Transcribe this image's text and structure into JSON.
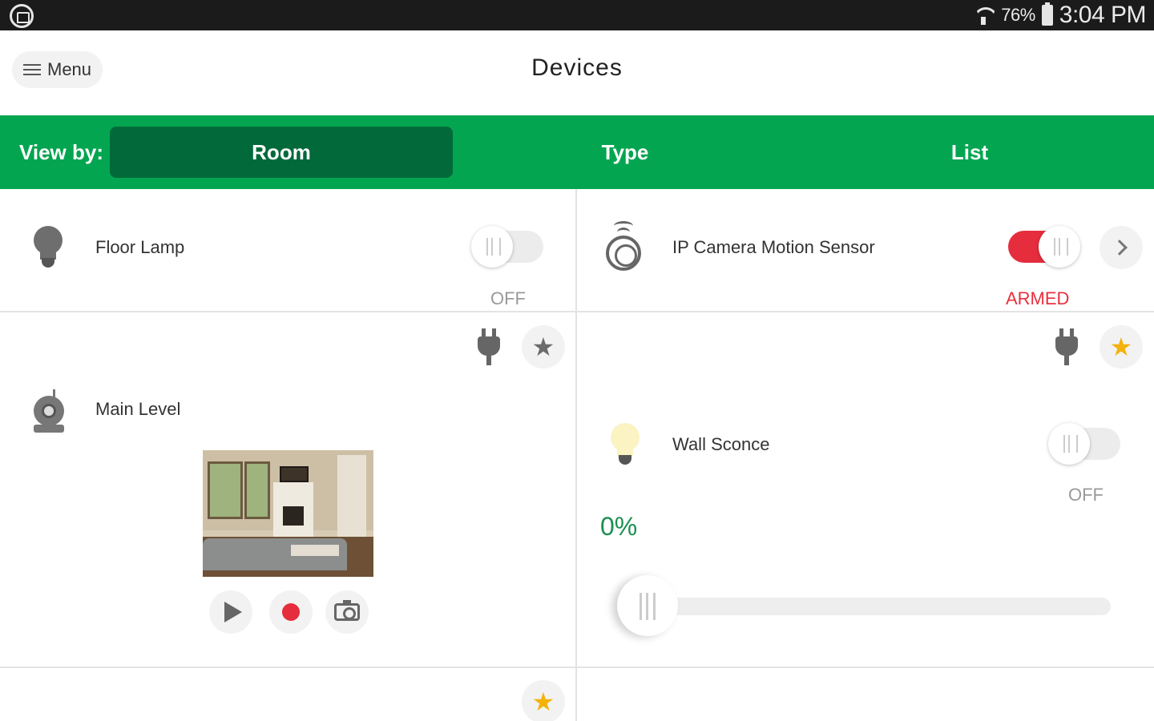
{
  "status_bar": {
    "battery": "76%",
    "time": "3:04 PM"
  },
  "header": {
    "menu_label": "Menu",
    "title": "Devices"
  },
  "view_by": {
    "label": "View by:",
    "tabs": [
      {
        "label": "Room",
        "active": true
      },
      {
        "label": "Type",
        "active": false
      },
      {
        "label": "List",
        "active": false
      }
    ]
  },
  "devices": {
    "floor_lamp": {
      "name": "Floor Lamp",
      "state": "OFF",
      "icon": "bulb-icon"
    },
    "motion_sensor": {
      "name": "IP Camera Motion Sensor",
      "state": "ARMED",
      "icon": "motion-sensor-icon"
    },
    "camera": {
      "name": "Main Level",
      "icon": "camera-icon"
    },
    "wall_sconce": {
      "name": "Wall Sconce",
      "state": "OFF",
      "dim_level": "0%",
      "dim_fraction": 0,
      "icon": "bulb-icon"
    }
  },
  "colors": {
    "brand_green": "#04a550",
    "active_tab": "#026a3a",
    "armed_red": "#e52d3d",
    "favorite_gold": "#f4b20d",
    "dim_green": "#1b8f52"
  }
}
